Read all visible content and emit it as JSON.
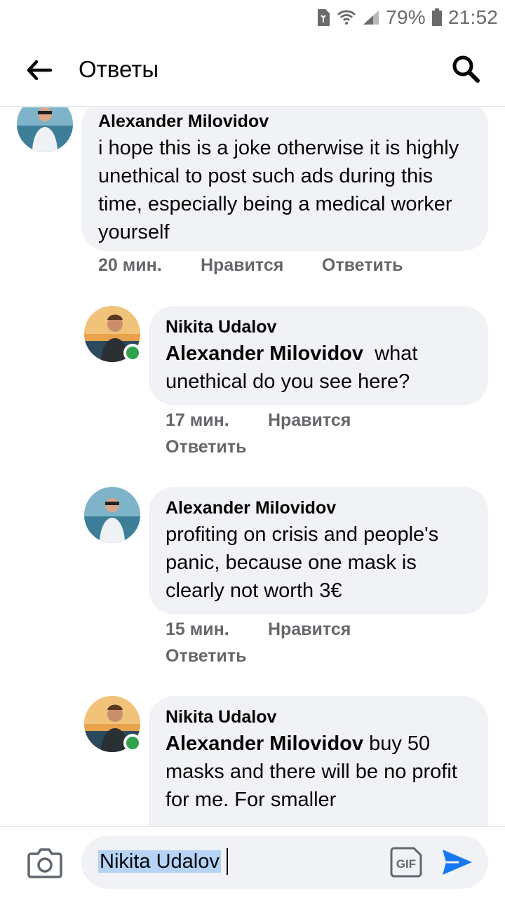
{
  "status_bar": {
    "battery": "79%",
    "time": "21:52",
    "icons": [
      "sim-icon",
      "wifi-icon",
      "signal-icon",
      "battery-icon"
    ]
  },
  "header": {
    "title": "Ответы",
    "back_icon": "arrow-left-icon",
    "search_icon": "search-icon"
  },
  "comments": [
    {
      "author": "Alexander Milovidov",
      "mention": "",
      "text": "i hope this is a joke otherwise it is highly unethical to post such ads during this time, especially being a medical worker yourself",
      "time": "20 мин.",
      "like": "Нравится",
      "reply": "Ответить",
      "online": false
    },
    {
      "author": "Nikita Udalov",
      "mention": "Alexander Milovidov",
      "text": "what unethical do you see here?",
      "time": "17 мин.",
      "like": "Нравится",
      "reply": "Ответить",
      "online": true
    },
    {
      "author": "Alexander Milovidov",
      "mention": "",
      "text": "profiting on crisis and people's panic, because one mask is clearly not worth 3€",
      "time": "15 мин.",
      "like": "Нравится",
      "reply": "Ответить",
      "online": false
    },
    {
      "author": "Nikita Udalov",
      "mention": "Alexander Milovidov",
      "text": "buy 50 masks and there will be no profit for me. For smaller",
      "online": true
    }
  ],
  "composer": {
    "value": "Nikita Udalov",
    "camera_icon": "camera-icon",
    "gif_icon": "gif-icon",
    "send_icon": "send-icon"
  },
  "colors": {
    "bubble": "#f0f2f5",
    "meta_text": "#65676b",
    "online": "#31a24c",
    "send": "#1877f2"
  }
}
